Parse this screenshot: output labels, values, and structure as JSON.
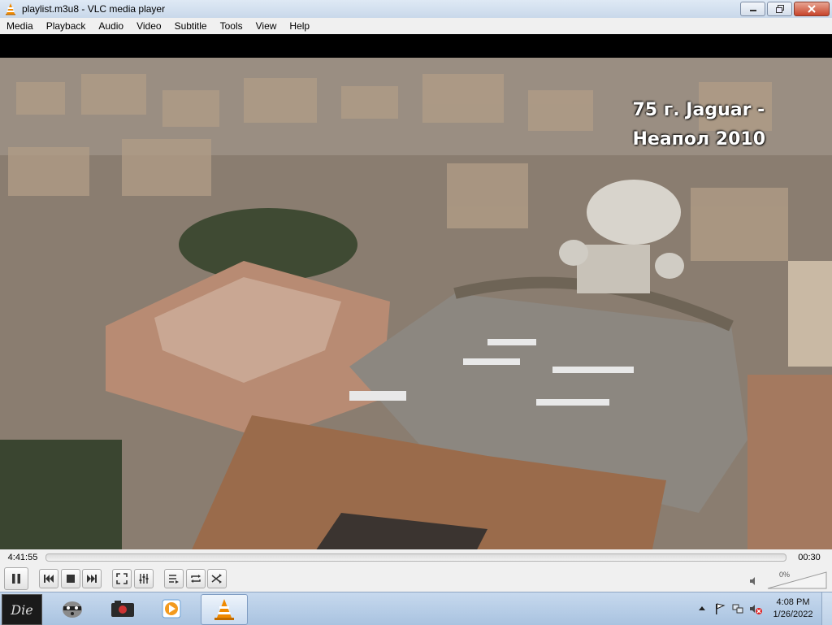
{
  "window": {
    "title": "playlist.m3u8 - VLC media player"
  },
  "menubar": {
    "items": [
      "Media",
      "Playback",
      "Audio",
      "Video",
      "Subtitle",
      "Tools",
      "View",
      "Help"
    ]
  },
  "video": {
    "overlay_line1": "75 г. Jaguar -",
    "overlay_line2": "Неапол 2010"
  },
  "seek": {
    "elapsed": "4:41:55",
    "remaining": "00:30",
    "position_fraction": 0.0
  },
  "volume": {
    "percent_label": "0%"
  },
  "taskbar": {
    "clock_time": "4:08 PM",
    "clock_date": "1/26/2022",
    "apps": [
      "die-icon",
      "raccoon-icon",
      "camera-icon",
      "media-player-icon",
      "vlc-cone-icon"
    ]
  },
  "colors": {
    "titlebar": "#c9d8ea",
    "menubar": "#f0f0f0",
    "vlc_orange": "#f08a00",
    "taskbar": "#a9c3e0"
  }
}
